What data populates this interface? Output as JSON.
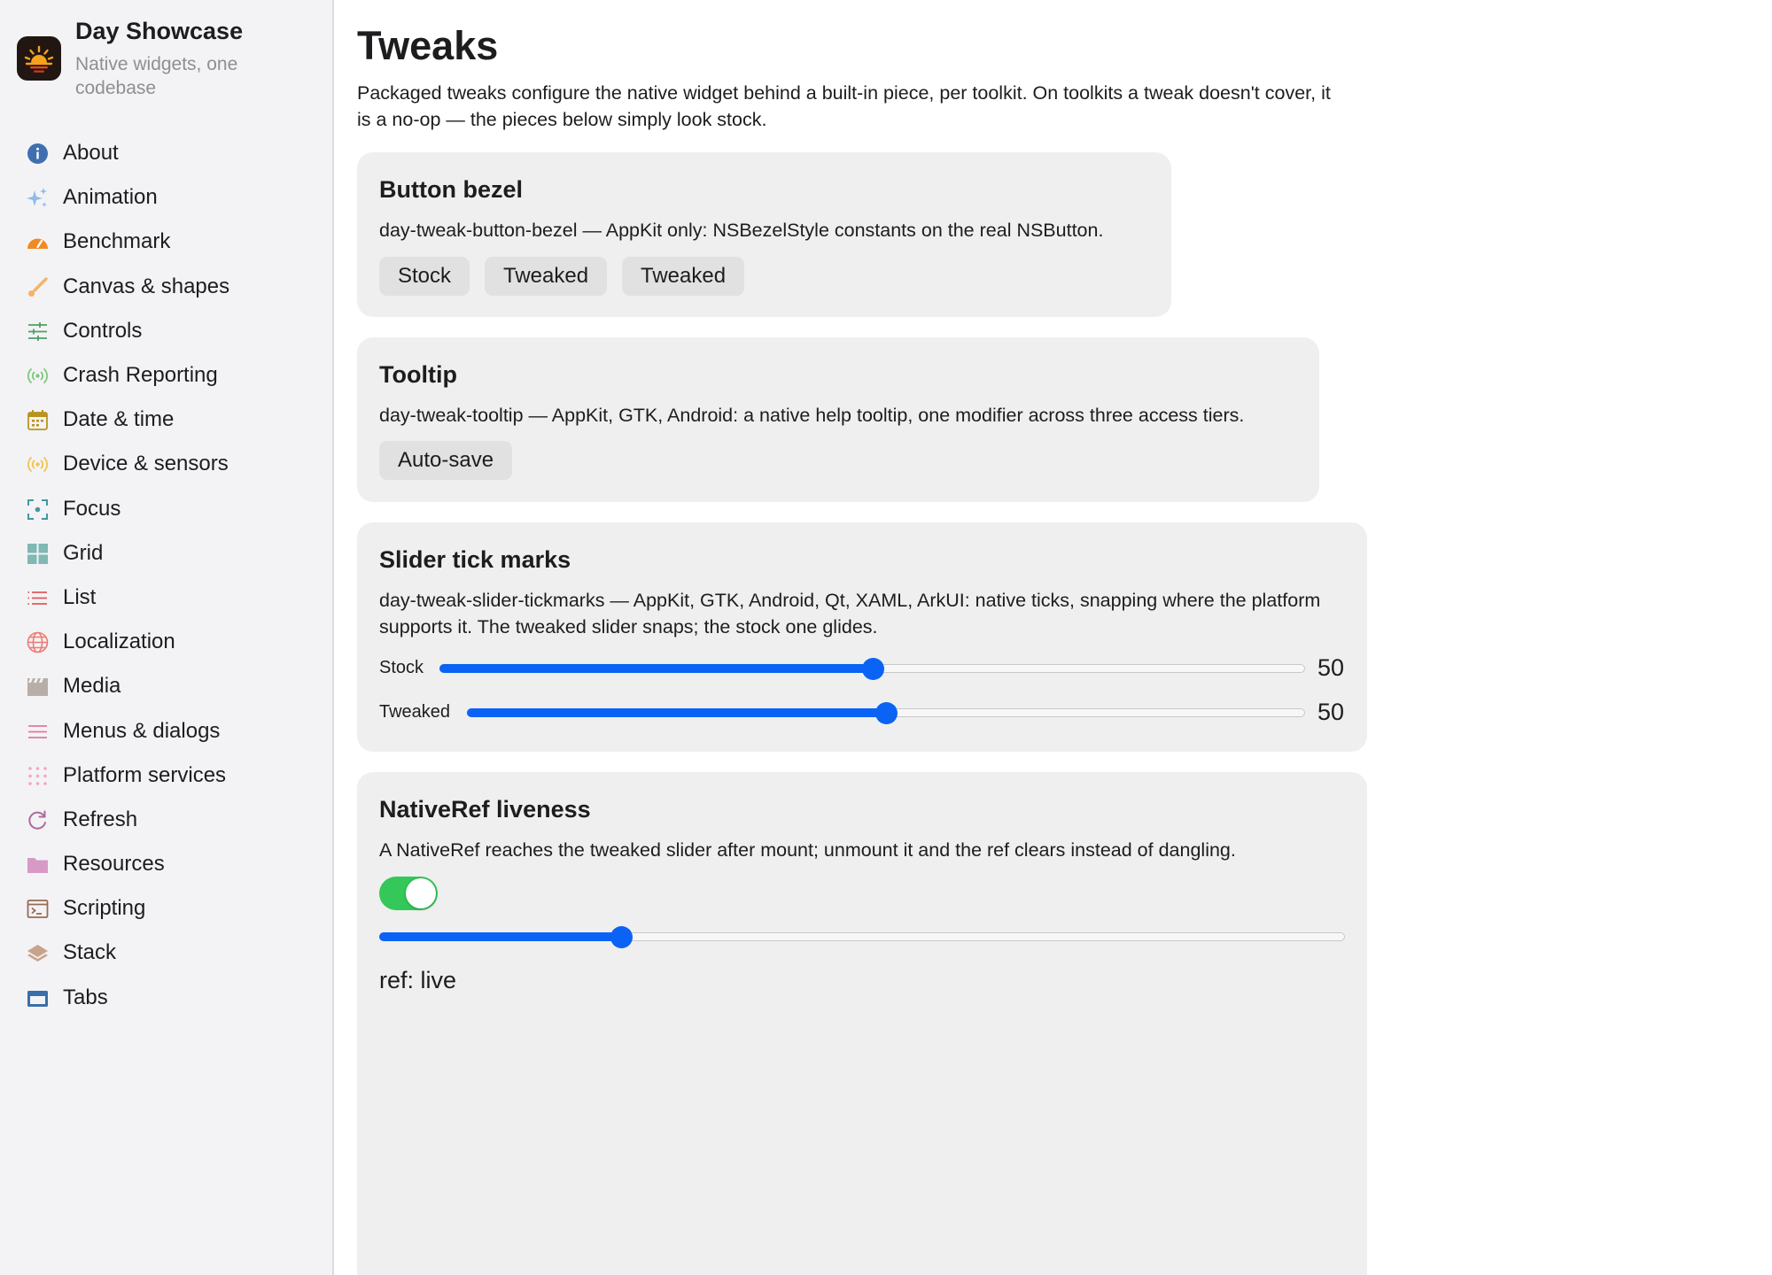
{
  "app": {
    "title": "Day Showcase",
    "subtitle": "Native widgets, one codebase",
    "icon": "sunrise-icon"
  },
  "sidebar": {
    "items": [
      {
        "label": "About",
        "icon": "info-icon"
      },
      {
        "label": "Animation",
        "icon": "sparkles-icon"
      },
      {
        "label": "Benchmark",
        "icon": "speedometer-icon"
      },
      {
        "label": "Canvas & shapes",
        "icon": "brush-icon"
      },
      {
        "label": "Controls",
        "icon": "sliders-icon"
      },
      {
        "label": "Crash Reporting",
        "icon": "broadcast-icon"
      },
      {
        "label": "Date & time",
        "icon": "calendar-icon"
      },
      {
        "label": "Device & sensors",
        "icon": "sensor-icon"
      },
      {
        "label": "Focus",
        "icon": "focus-icon"
      },
      {
        "label": "Grid",
        "icon": "grid-icon"
      },
      {
        "label": "List",
        "icon": "list-icon"
      },
      {
        "label": "Localization",
        "icon": "globe-icon"
      },
      {
        "label": "Media",
        "icon": "clapperboard-icon"
      },
      {
        "label": "Menus & dialogs",
        "icon": "menu-icon"
      },
      {
        "label": "Platform services",
        "icon": "dots-grid-icon"
      },
      {
        "label": "Refresh",
        "icon": "refresh-icon"
      },
      {
        "label": "Resources",
        "icon": "folder-icon"
      },
      {
        "label": "Scripting",
        "icon": "terminal-icon"
      },
      {
        "label": "Stack",
        "icon": "layers-icon"
      },
      {
        "label": "Tabs",
        "icon": "tabs-icon"
      }
    ]
  },
  "page": {
    "title": "Tweaks",
    "description": "Packaged tweaks configure the native widget behind a built-in piece, per toolkit. On toolkits a tweak doesn't cover, it is a no-op — the pieces below simply look stock."
  },
  "cards": {
    "bezel": {
      "title": "Button bezel",
      "description": "day-tweak-button-bezel — AppKit only: NSBezelStyle constants on the real NSButton.",
      "buttons": [
        "Stock",
        "Tweaked",
        "Tweaked"
      ]
    },
    "tooltip": {
      "title": "Tooltip",
      "description": "day-tweak-tooltip — AppKit, GTK, Android: a native help tooltip, one modifier across three access tiers.",
      "button": "Auto-save"
    },
    "ticks": {
      "title": "Slider tick marks",
      "description": "day-tweak-slider-tickmarks — AppKit, GTK, Android, Qt, XAML, ArkUI: native ticks, snapping where the platform supports it. The tweaked slider snaps; the stock one glides.",
      "sliders": [
        {
          "label": "Stock",
          "value": "50",
          "fraction": 0.5
        },
        {
          "label": "Tweaked",
          "value": "50",
          "fraction": 0.5
        }
      ]
    },
    "nativeref": {
      "title": "NativeRef liveness",
      "description": "A NativeRef reaches the tweaked slider after mount; unmount it and the ref clears instead of dangling.",
      "toggle_on": true,
      "slider_fraction": 0.25,
      "status": "ref: live"
    }
  },
  "colors": {
    "accent": "#0a63f5",
    "toggle_on": "#34c759",
    "card_bg": "#efefef",
    "sidebar_bg": "#f3f3f5"
  }
}
